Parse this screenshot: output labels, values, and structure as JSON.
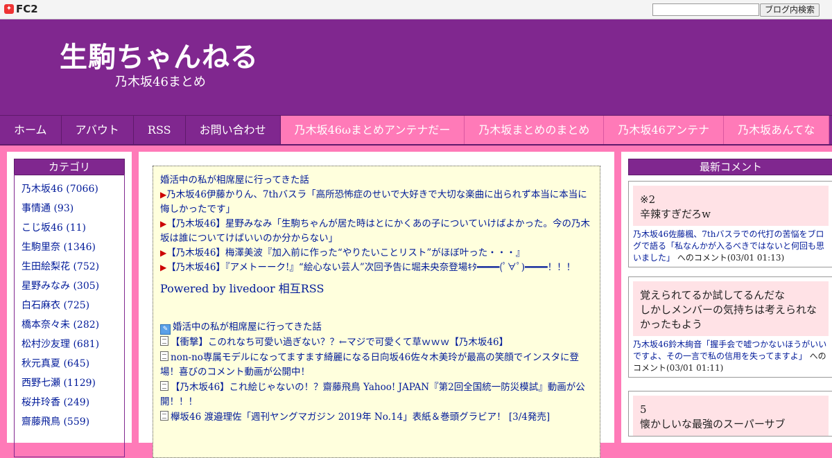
{
  "fc2": {
    "logo": "FC2",
    "search_button": "ブログ内検索"
  },
  "header": {
    "title": "生駒ちゃんねる",
    "subtitle": "乃木坂46まとめ"
  },
  "nav": [
    {
      "label": "ホーム",
      "style": "purple"
    },
    {
      "label": "アバウト",
      "style": "purple"
    },
    {
      "label": "RSS",
      "style": "purple"
    },
    {
      "label": "お問い合わせ",
      "style": "purple"
    },
    {
      "label": "乃木坂46ωまとめアンテナだー",
      "style": "pink"
    },
    {
      "label": "乃木坂まとめのまとめ",
      "style": "pink"
    },
    {
      "label": "乃木坂46アンテナ",
      "style": "pink"
    },
    {
      "label": "乃木坂あんてな",
      "style": "pink"
    }
  ],
  "categories": {
    "heading": "カテゴリ",
    "items": [
      "乃木坂46 (7066)",
      "事情通 (93)",
      "こじ坂46 (11)",
      "生駒里奈 (1346)",
      "生田絵梨花 (752)",
      "星野みなみ (305)",
      "白石麻衣 (725)",
      "橋本奈々未 (282)",
      "松村沙友理 (681)",
      "秋元真夏 (645)",
      "西野七瀬 (1129)",
      "桜井玲香 (249)",
      "齋藤飛鳥 (559)"
    ]
  },
  "rss": {
    "top_links": [
      {
        "marker": "",
        "text": "婚活中の私が相席屋に行ってきた話"
      },
      {
        "marker": "▶",
        "text": "乃木坂46伊藤かりん、7thバスラ「高所恐怖症のせいで大好きで大切な楽曲に出られず本当に本当に悔しかったです」"
      },
      {
        "marker": "▶",
        "text": "【乃木坂46】星野みなみ「生駒ちゃんが居た時はとにかくあの子についていけばよかった。今の乃木坂は誰についてけばいいのか分からない」"
      },
      {
        "marker": "▶",
        "text": "【乃木坂46】梅澤美波『加入前に作った“やりたいことリスト”がほぼ叶った・・・』"
      },
      {
        "marker": "▶",
        "text": "【乃木坂46】『アメトーーク!』“絵心ない芸人”次回予告に堀未央奈登場ｷﾀ━━━━(ﾟ∀ﾟ)━━━━！！！"
      }
    ],
    "powered": "Powered by livedoor 相互RSS",
    "bottom_links": [
      {
        "icon": "edit",
        "text": "婚活中の私が相席屋に行ってきた話"
      },
      {
        "icon": "doc",
        "text": "【衝撃】このれなち可愛い過ぎない？？←マジで可愛くて草ｗｗｗ【乃木坂46】"
      },
      {
        "icon": "doc",
        "text": "non-no専属モデルになってますます綺麗になる日向坂46佐々木美玲が最高の笑顔でインスタに登場！喜びのコメント動画が公開中！"
      },
      {
        "icon": "doc",
        "text": "【乃木坂46】これ絵じゃないの！？齋藤飛鳥 Yahoo! JAPAN『第2回全国統一防災模試』動画が公開！！！"
      },
      {
        "icon": "doc",
        "text": "欅坂46 渡邉理佐「週刊ヤングマガジン 2019年 No.14」表紙＆巻頭グラビア！ [3/4発売]"
      }
    ]
  },
  "comments": {
    "heading": "最新コメント",
    "items": [
      {
        "body": "※2\n辛辣すぎだろw",
        "article": "乃木坂46佐藤楓、7thバスラでの代打の苦悩をブログで語る「私なんかが入るべきではないと何回も思いました」",
        "suffix": " へのコメント(03/01 01:13)"
      },
      {
        "body": "覚えられてるか試してるんだな\nしかしメンバーの気持ちは考えられなかったもよう",
        "article": "乃木坂46鈴木絢音「握手会で嘘つかないほうがいいですよ、その一言で私の信用を失ってますよ」",
        "suffix": " へのコメント(03/01 01:11)"
      },
      {
        "body": "5\n懐かしいな最強のスーパーサブ",
        "article": "",
        "suffix": ""
      }
    ]
  }
}
